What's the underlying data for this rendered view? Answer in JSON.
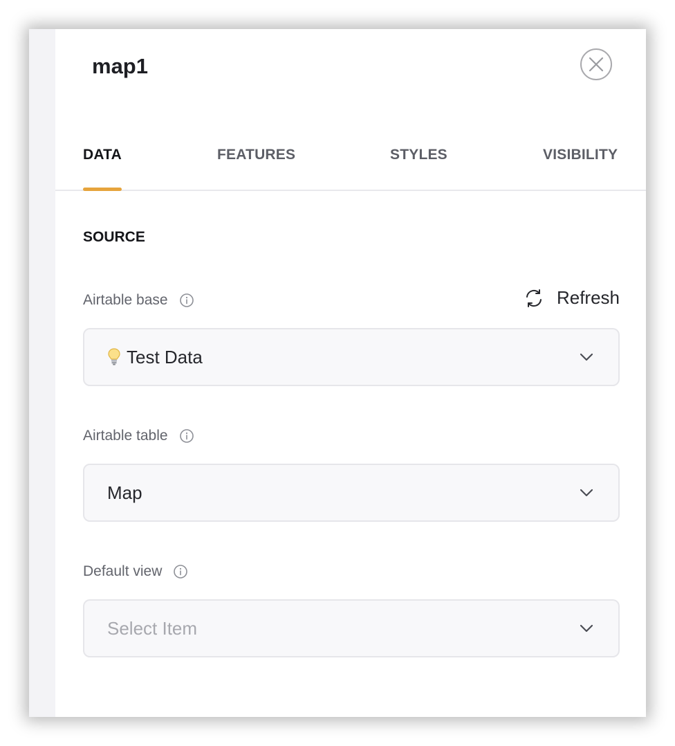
{
  "panel": {
    "title": "map1"
  },
  "tabs": [
    {
      "label": "DATA",
      "active": true
    },
    {
      "label": "FEATURES",
      "active": false
    },
    {
      "label": "STYLES",
      "active": false
    },
    {
      "label": "VISIBILITY",
      "active": false
    }
  ],
  "source": {
    "section_title": "SOURCE",
    "refresh_label": "Refresh",
    "airtable_base": {
      "label": "Airtable base",
      "value": "Test Data",
      "icon": "lightbulb-icon"
    },
    "airtable_table": {
      "label": "Airtable table",
      "value": "Map"
    },
    "default_view": {
      "label": "Default view",
      "placeholder": "Select Item"
    }
  },
  "colors": {
    "accent": "#e6a43c",
    "text_primary": "#15161a",
    "text_muted": "#62646c",
    "field_bg": "#f8f8fa"
  }
}
